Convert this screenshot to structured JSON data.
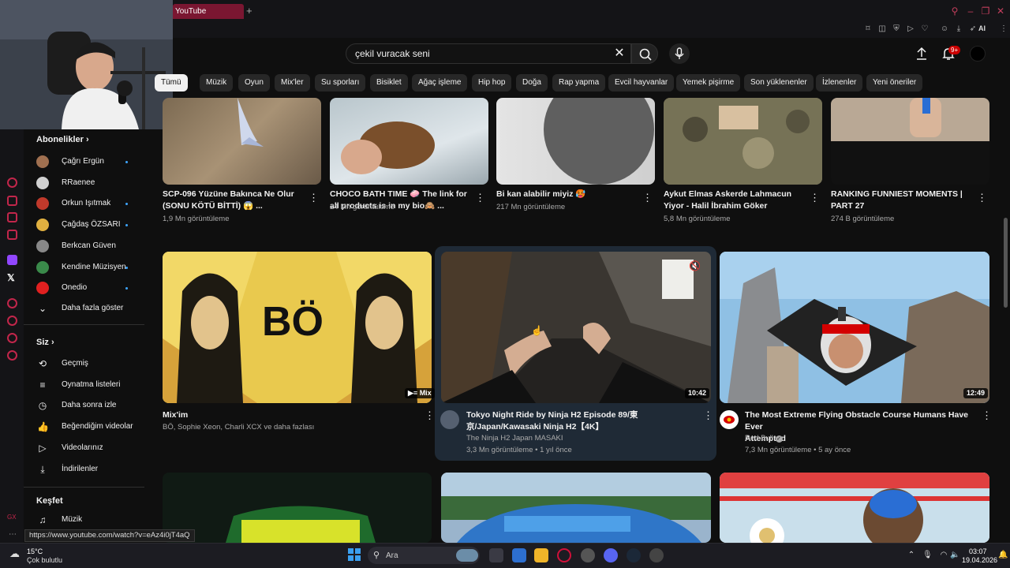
{
  "browser": {
    "tab_title": "YouTube",
    "new_tab": "+",
    "toolbar_ai": "AI"
  },
  "search": {
    "query": "çekil vuracak seni",
    "clear": "✕"
  },
  "notifications": {
    "badge": "9+"
  },
  "chips": [
    "Tümü",
    "Müzik",
    "Oyun",
    "Mix'ler",
    "Su sporları",
    "Bisiklet",
    "Ağaç işleme",
    "Hip hop",
    "Doğa",
    "Rap yapma",
    "Evcil hayvanlar",
    "Yemek pişirme",
    "Son yüklenenler",
    "İzlenenler",
    "Yeni öneriler"
  ],
  "sidebar": {
    "subscriptions_header": "Abonelikler",
    "subscriptions": [
      {
        "name": "Çağrı Ergün",
        "color": "#a07050"
      },
      {
        "name": "RRaenee",
        "color": "#d0d0d0"
      },
      {
        "name": "Orkun Işıtmak",
        "color": "#c0392b"
      },
      {
        "name": "Çağdaş ÖZSARI",
        "color": "#e0b040"
      },
      {
        "name": "Berkcan Güven",
        "color": "#888888"
      },
      {
        "name": "Kendine Müzisyen",
        "color": "#3a8a4a"
      },
      {
        "name": "Onedio",
        "color": "#e02020"
      }
    ],
    "show_more": "Daha fazla göster",
    "you_header": "Siz",
    "you_items": [
      {
        "label": "Geçmiş",
        "icon": "history-icon"
      },
      {
        "label": "Oynatma listeleri",
        "icon": "playlists-icon"
      },
      {
        "label": "Daha sonra izle",
        "icon": "watch-later-icon"
      },
      {
        "label": "Beğendiğim videolar",
        "icon": "like-icon"
      },
      {
        "label": "Videolarınız",
        "icon": "your-videos-icon"
      },
      {
        "label": "İndirilenler",
        "icon": "download-icon"
      }
    ],
    "explore_header": "Keşfet",
    "explore_items": [
      {
        "label": "Müzik",
        "icon": "music-icon"
      }
    ]
  },
  "videos_row1": [
    {
      "title1": "SCP-096 Yüzüne Bakınca Ne Olur",
      "title2": "(SONU KÖTÜ BİTTİ) 😱 ...",
      "meta": "1,9 Mn görüntüleme"
    },
    {
      "title1": "CHOCO BATH TIME 🧼 The link for",
      "title2": "all products is in my bio🙈 ...",
      "meta": "24 Mn görüntüleme"
    },
    {
      "title1": "Bi kan alabilir miyiz 🥵",
      "title2": "",
      "meta": "217 Mn görüntüleme"
    },
    {
      "title1": "Aykut Elmas Askerde Lahmacun",
      "title2": "Yiyor - Halil İbrahim Göker",
      "meta": "5,8 Mn görüntüleme"
    },
    {
      "title1": "RANKING FUNNIEST MOMENTS |",
      "title2": "PART 27",
      "meta": "274 B görüntüleme"
    }
  ],
  "videos_row2": [
    {
      "title1": "Mix'im",
      "title2": "",
      "channel": "BÖ, Sophie Xeon, Charli XCX ve daha fazlası",
      "meta": "",
      "badge": "Mix",
      "thumb_text": "BÖ"
    },
    {
      "title1": "Tokyo Night Ride by Ninja H2  Episode 89/東",
      "title2": "京/Japan/Kawasaki Ninja H2【4K】",
      "channel": "The Ninja H2 Japan MASAKI",
      "meta": "3,3 Mn görüntüleme • 1 yıl önce",
      "duration": "10:42"
    },
    {
      "title1": "The Most Extreme Flying Obstacle Course Humans Have Ever",
      "title2": "Attempted",
      "channel": "Red Bull",
      "meta": "7,3 Mn görüntüleme • 5 ay önce",
      "duration": "12:49"
    }
  ],
  "status_url": "https://www.youtube.com/watch?v=eAz4i0jT4aQ",
  "taskbar": {
    "temp": "15°C",
    "weather": "Çok bulutlu",
    "search_label": "Ara",
    "time": "03:07",
    "date": "19.04.2026"
  }
}
